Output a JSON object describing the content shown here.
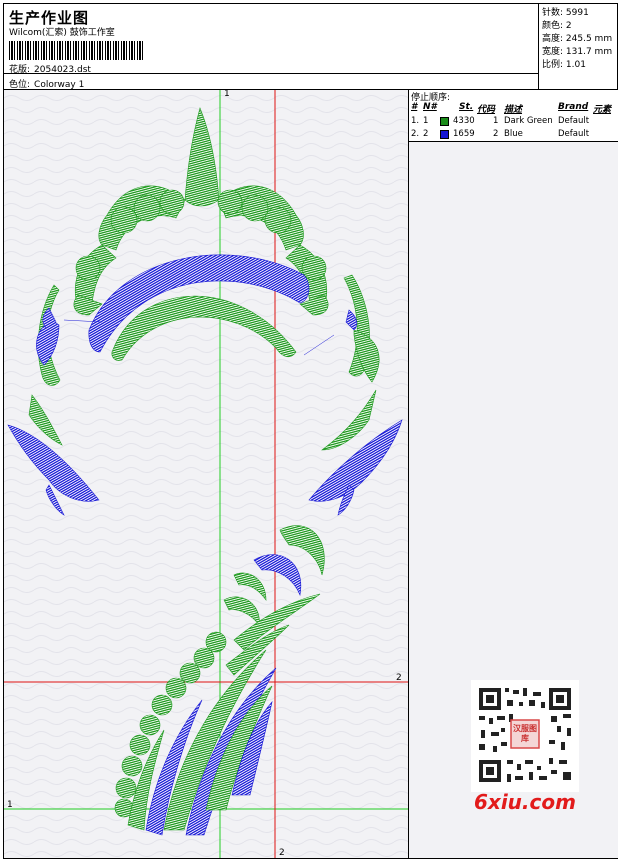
{
  "header": {
    "title": "生产作业图",
    "company": "Wilcom(汇索) 鼓饰工作室",
    "design_label": "花版:",
    "design_value": "2054023.dst",
    "colorway_label": "色位:",
    "colorway_value": "Colorway 1"
  },
  "stats": [
    {
      "label": "针数:",
      "value": "5991"
    },
    {
      "label": "颜色:",
      "value": "2"
    },
    {
      "label": "高度:",
      "value": "245.5 mm"
    },
    {
      "label": "宽度:",
      "value": "131.7 mm"
    },
    {
      "label": "比例:",
      "value": "1.01"
    }
  ],
  "stop_sequence": {
    "title": "停止顺序:",
    "columns": {
      "num": "#",
      "n": "N#",
      "st": "St.",
      "code": "代码",
      "desc": "描述",
      "brand": "Brand",
      "elem": "元素"
    },
    "rows": [
      {
        "num": "1.",
        "n": "1",
        "stitches": "4330",
        "code": "1",
        "desc": "Dark Green",
        "brand": "Default",
        "color": "#1a8c1a"
      },
      {
        "num": "2.",
        "n": "2",
        "stitches": "1659",
        "code": "2",
        "desc": "Blue",
        "brand": "Default",
        "color": "#1414d2"
      }
    ]
  },
  "guides": {
    "green_top": "1",
    "green_left": "1",
    "red_right": "2",
    "red_bottom": "2"
  },
  "colors": {
    "green": "#1f9a1f",
    "blue": "#1a1ad6",
    "guide_green": "#22cc22",
    "guide_red": "#dd1111",
    "brand_red": "#e21b1b"
  },
  "watermark": {
    "text": "6xiu.com",
    "seal_text": "汉服图库"
  }
}
